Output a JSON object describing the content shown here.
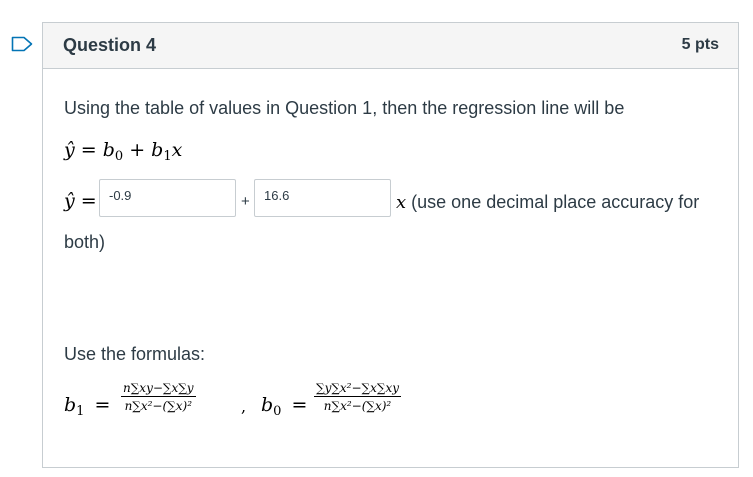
{
  "question": {
    "title": "Question 4",
    "points": "5 pts"
  },
  "prompt": "Using the table of values in Question 1, then the regression line will be",
  "equation": {
    "lhs": "ŷ = b",
    "sub0": "0",
    "mid": " + b",
    "sub1": "1",
    "rhs": "x"
  },
  "answer": {
    "yhat_eq": "ŷ =",
    "b0_value": "-0.9",
    "plus": "+",
    "b1_value": "16.6",
    "x_symbol": "x",
    "instruction_line1": " (use one decimal place accuracy for",
    "instruction_line2": "both)"
  },
  "formulas": {
    "heading": "Use the formulas:",
    "b1_lhs": "b",
    "b1_sub": "1",
    "equals": "=",
    "b1_numerator": "n∑xy−∑x∑y",
    "b1_denominator": "n∑x²−(∑x)²",
    "comma": ",",
    "b0_lhs": "b",
    "b0_sub": "0",
    "b0_numerator": "∑y∑x²−∑x∑xy",
    "b0_denominator": "n∑x²−(∑x)²"
  },
  "colors": {
    "flag_outline": "#0374b5",
    "border": "#c7cdd1",
    "header_bg": "#f5f5f5",
    "text": "#2d3b45"
  }
}
